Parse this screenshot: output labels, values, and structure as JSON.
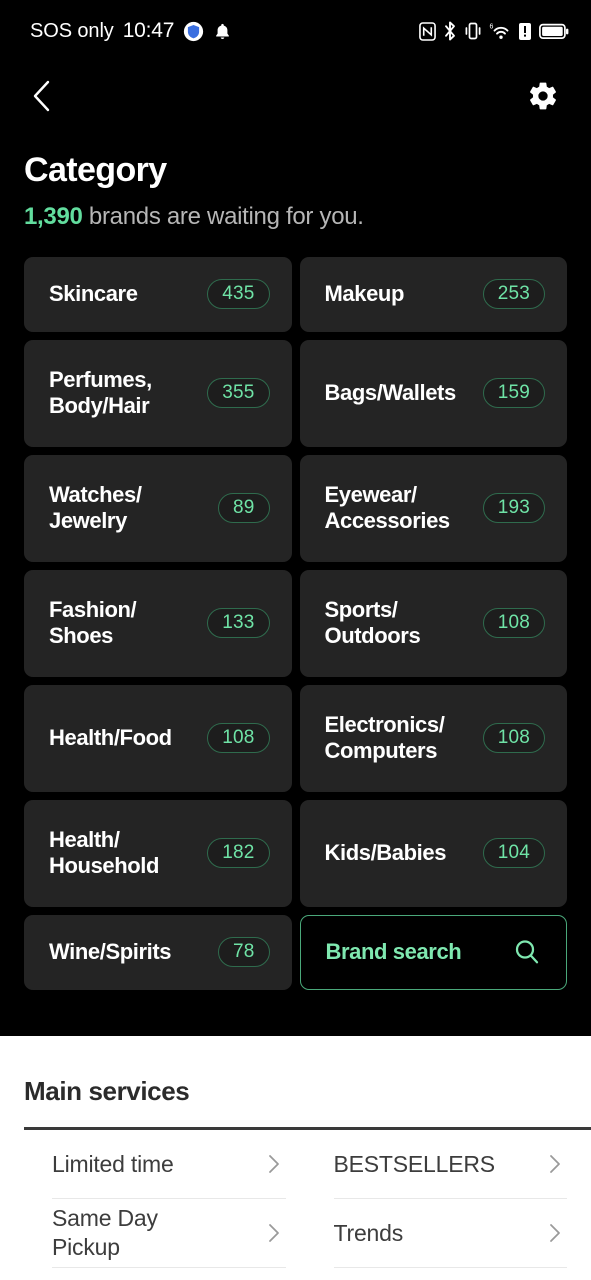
{
  "status_bar": {
    "carrier": "SOS only",
    "time": "10:47",
    "left_icons": [
      "shield-icon",
      "bell-icon"
    ],
    "right_icons": [
      "nfc-icon",
      "bluetooth-icon",
      "vibrate-icon",
      "wifi6-icon",
      "sim-alert-icon",
      "battery-icon"
    ]
  },
  "nav": {
    "back_icon": "chevron-left-icon",
    "settings_icon": "gear-icon"
  },
  "header": {
    "title": "Category",
    "count": "1,390",
    "subtitle_rest": " brands are waiting for you."
  },
  "categories": [
    {
      "label": "Skincare",
      "count": "435",
      "tall": false
    },
    {
      "label": "Makeup",
      "count": "253",
      "tall": false
    },
    {
      "label": "Perfumes,\nBody/Hair",
      "count": "355",
      "tall": true
    },
    {
      "label": "Bags/Wallets",
      "count": "159",
      "tall": true
    },
    {
      "label": "Watches/\nJewelry",
      "count": "89",
      "tall": true
    },
    {
      "label": "Eyewear/\nAccessories",
      "count": "193",
      "tall": true
    },
    {
      "label": "Fashion/\nShoes",
      "count": "133",
      "tall": true
    },
    {
      "label": "Sports/\nOutdoors",
      "count": "108",
      "tall": true
    },
    {
      "label": "Health/Food",
      "count": "108",
      "tall": true
    },
    {
      "label": "Electronics/\nComputers",
      "count": "108",
      "tall": true
    },
    {
      "label": "Health/\nHousehold",
      "count": "182",
      "tall": true
    },
    {
      "label": "Kids/Babies",
      "count": "104",
      "tall": true
    },
    {
      "label": "Wine/Spirits",
      "count": "78",
      "tall": false
    }
  ],
  "brand_search": {
    "label": "Brand search",
    "icon": "search-icon"
  },
  "main_services": {
    "title": "Main services",
    "left_items": [
      {
        "label": "Limited time"
      },
      {
        "label": "Same Day\nPickup"
      }
    ],
    "right_items": [
      {
        "label": "BESTSELLERS"
      },
      {
        "label": "Trends"
      }
    ]
  },
  "colors": {
    "background": "#000000",
    "tile": "#242424",
    "accent_green": "#62dd9e",
    "badge_text": "#6fe3a6",
    "badge_border": "#2f6b4d",
    "search_border": "#4aa87a",
    "search_text": "#7fe8b0",
    "subtitle_gray": "#b6b6b6",
    "sheet_background": "#ffffff",
    "sheet_text": "#3d3d3d"
  }
}
